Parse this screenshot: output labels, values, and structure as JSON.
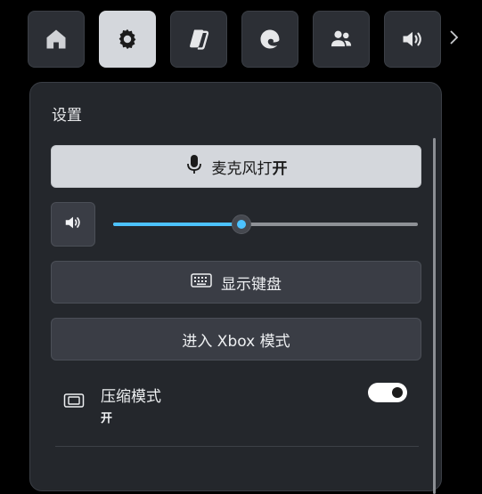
{
  "topbar": {
    "tiles": [
      {
        "icon": "home-icon"
      },
      {
        "icon": "gear-icon"
      },
      {
        "icon": "copilot-icon"
      },
      {
        "icon": "edge-icon"
      },
      {
        "icon": "people-icon"
      },
      {
        "icon": "speaker-icon"
      }
    ],
    "active_index": 1,
    "more_icon": "chevron-right-icon"
  },
  "settings": {
    "title": "设置",
    "mic_button": {
      "label": "麦克风打",
      "state": "开",
      "icon": "microphone-icon"
    },
    "volume": {
      "icon": "speaker-icon",
      "level": 0.42
    },
    "keyboard_button": {
      "label": "显示键盘",
      "icon": "keyboard-icon"
    },
    "xbox_button": {
      "label": "进入 Xbox 模式"
    },
    "compact_mode": {
      "title": "压缩模式",
      "state": "开",
      "icon": "compact-mode-icon",
      "toggle_on": true
    }
  },
  "colors": {
    "accent": "#4cc2ff",
    "panel": "#24272c",
    "tile": "#2c2f35",
    "tile_active": "#d4d7dc"
  }
}
